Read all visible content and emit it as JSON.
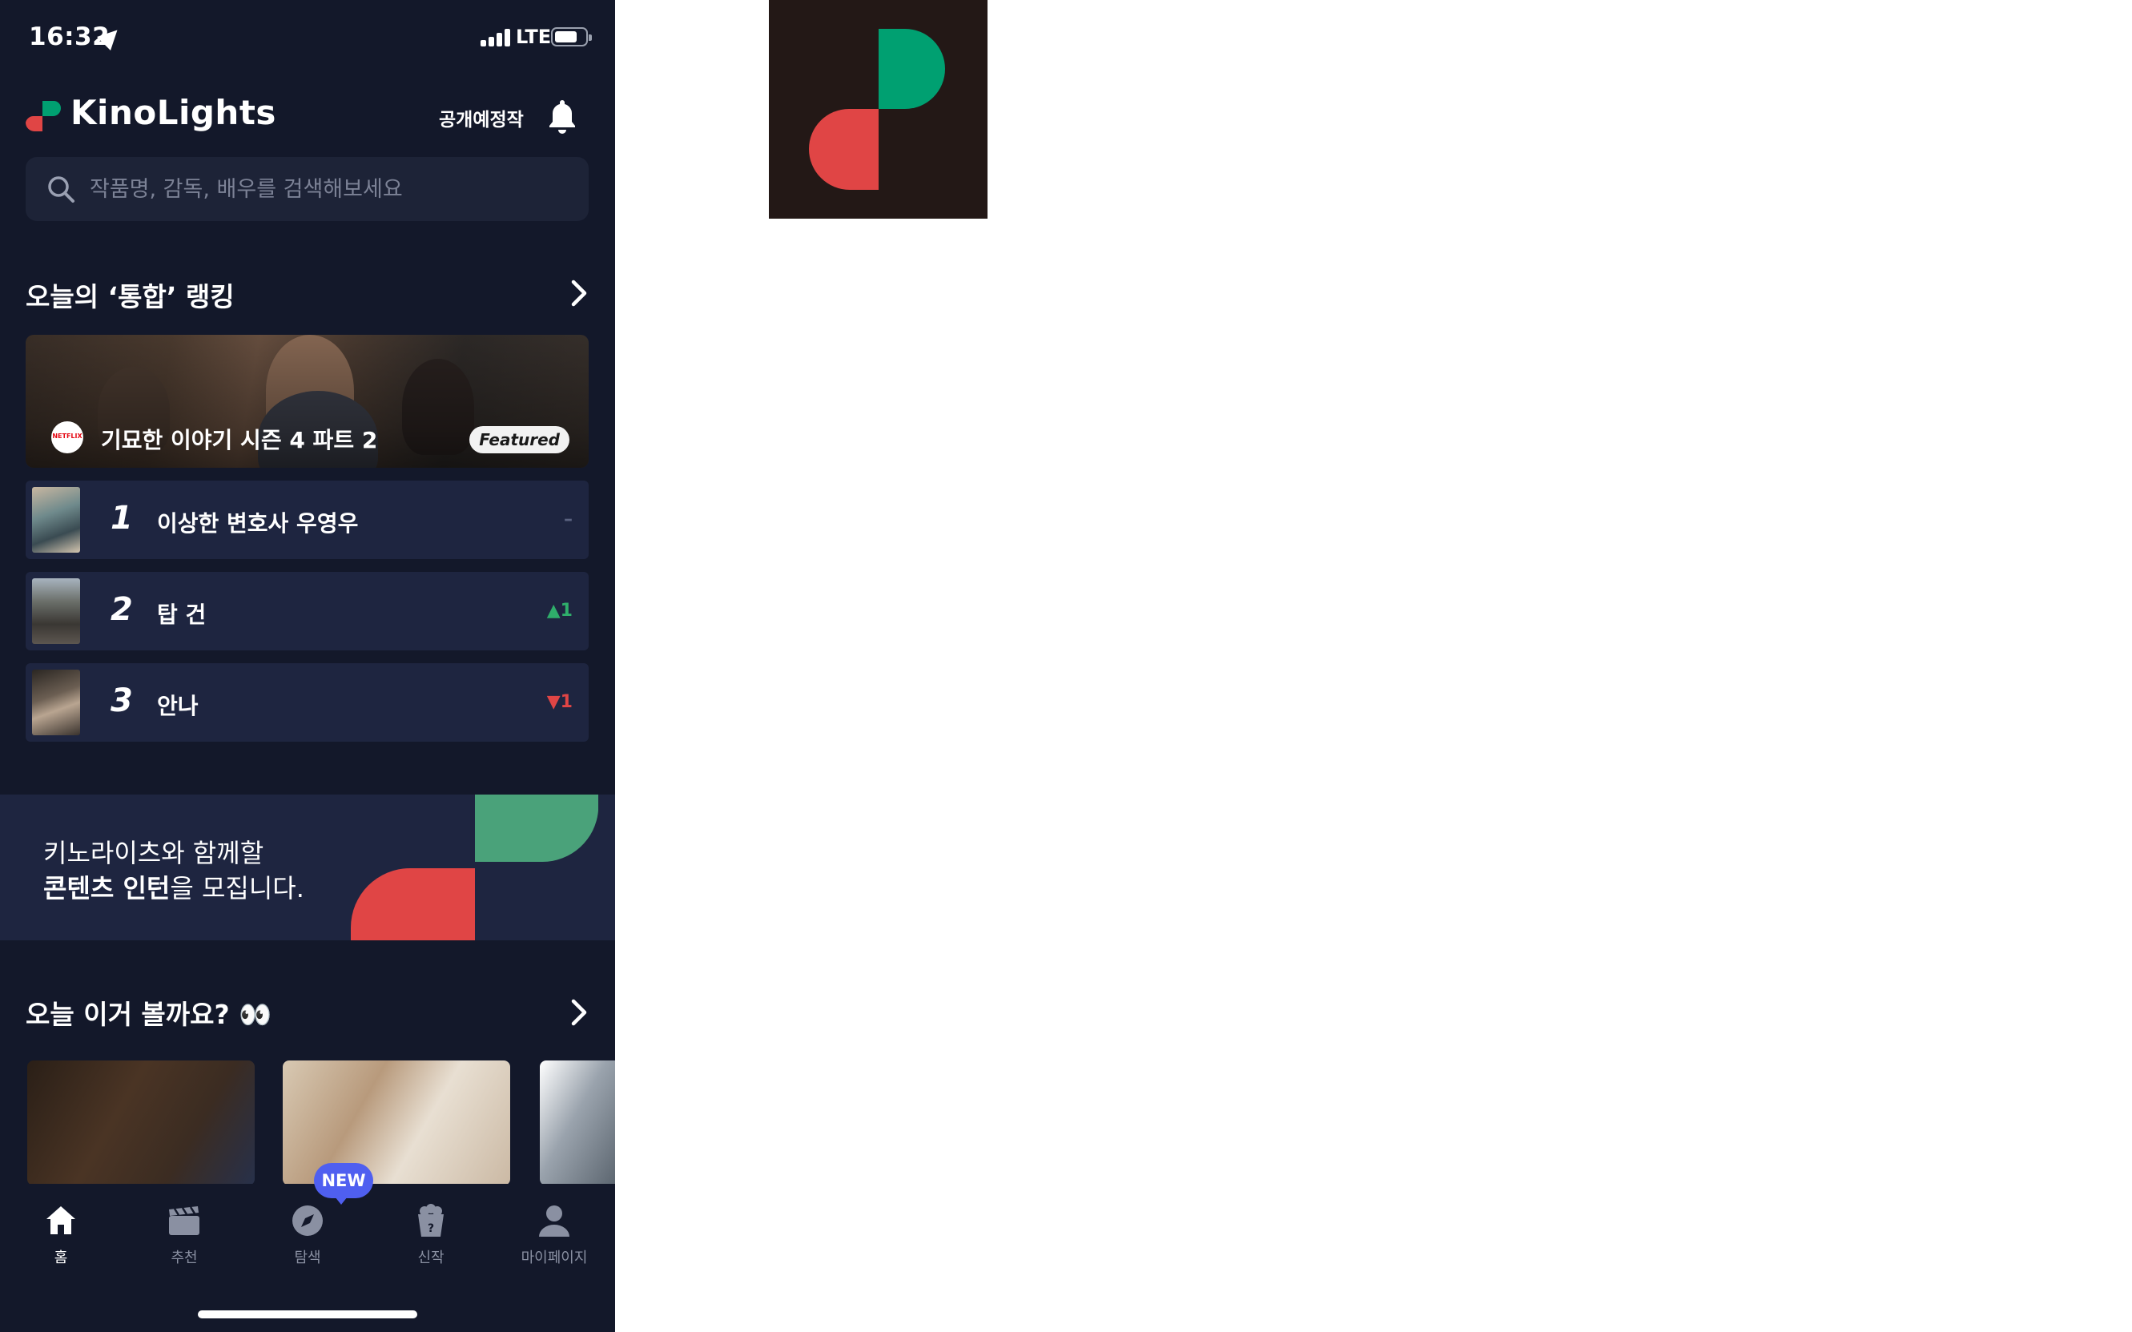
{
  "status_bar": {
    "time": "16:32",
    "network": "LTE"
  },
  "header": {
    "app_name": "KinoLights",
    "upcoming_label": "공개예정작"
  },
  "search": {
    "placeholder": "작품명, 감독, 배우를 검색해보세요"
  },
  "ranking": {
    "title": "오늘의 ‘통합’ 랭킹",
    "featured": {
      "title": "기묘한 이야기 시즌 4 파트 2",
      "provider": "NETFLIX",
      "badge": "Featured"
    },
    "items": [
      {
        "rank": "1",
        "title": "이상한 변호사 우영우",
        "change": "–",
        "change_dir": "same"
      },
      {
        "rank": "2",
        "title": "탑 건",
        "change": "▲1",
        "change_dir": "up"
      },
      {
        "rank": "3",
        "title": "안나",
        "change": "▼1",
        "change_dir": "down"
      }
    ]
  },
  "banner": {
    "line1": "키노라이츠와 함께할",
    "line2_bold": "콘텐츠 인턴",
    "line2_rest": "을 모집니다."
  },
  "recommendations": {
    "title": "오늘 이거 볼까요? 👀"
  },
  "bottom_nav": {
    "new_badge": "NEW",
    "items": [
      {
        "label": "홈",
        "icon": "home-icon",
        "active": true
      },
      {
        "label": "추천",
        "icon": "clapperboard-icon",
        "active": false
      },
      {
        "label": "탐색",
        "icon": "compass-icon",
        "active": false
      },
      {
        "label": "신작",
        "icon": "popcorn-icon",
        "active": false
      },
      {
        "label": "마이페이지",
        "icon": "person-icon",
        "active": false
      }
    ]
  },
  "colors": {
    "background": "#13182a",
    "card": "#1e2540",
    "brand_red": "#e04545",
    "brand_green": "#00a071",
    "up": "#2fae6b",
    "down": "#e04545",
    "new_badge": "#4f5ff0"
  }
}
